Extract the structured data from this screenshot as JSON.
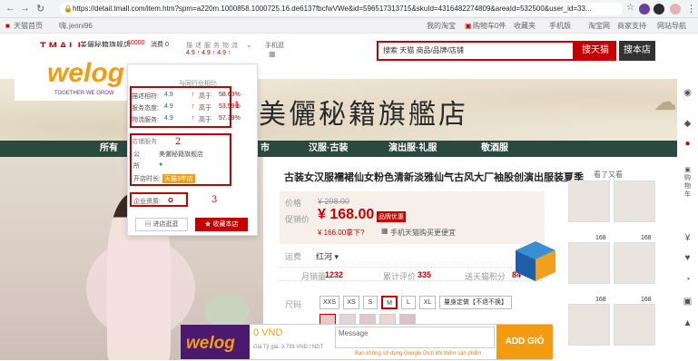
{
  "browser": {
    "url": "https://detail.tmall.com/item.htm?spm=a220m.1000858.1000725.16.de6137fbcfwVWe&id=596517313715&skuId=4316482274809&areaId=532500&user_id=33..."
  },
  "topbar": {
    "home": "天猫首页",
    "greeting": "嗨,",
    "user": "jenni96",
    "my_taobao": "我的淘宝",
    "cart": "购物车0件",
    "favorites": "收藏夹",
    "mobile": "手机版",
    "taobao": "淘宝网",
    "seller": "商家支持",
    "sitemap": "网站导航"
  },
  "shop_header": {
    "shop_name": "美儷秘籍旗舰店",
    "stat_labels": [
      "描",
      "述",
      "服",
      "务",
      "物",
      "流"
    ],
    "score_a": "4.9",
    "score_b": "4.9",
    "score_c": "4.9",
    "phone_label": "手机逛",
    "coupon": "10000",
    "cat": "消费 0"
  },
  "search": {
    "placeholder": "搜索 天猫 商品/品牌/店铺",
    "btn_tmall": "搜天猫",
    "btn_shop": "搜本店"
  },
  "banner": {
    "title": "美儷秘籍旗艦店"
  },
  "catnav": [
    "所有",
    "市",
    "汉服·古装",
    "演出服·礼服",
    "敬酒服"
  ],
  "popup": {
    "compare_header": "与同行业相比",
    "rows": [
      {
        "label": "描述相符:",
        "score": "4.9",
        "dir": "高于",
        "pct": "58.63%"
      },
      {
        "label": "服务态度:",
        "score": "4.9",
        "dir": "高于",
        "pct": "53.59%"
      },
      {
        "label": "物流服务:",
        "score": "4.9",
        "dir": "高于",
        "pct": "57.39%"
      }
    ],
    "service_header": "店铺服务",
    "company_label": "公",
    "company_name": "美儷秘籍旗舰店",
    "location_label": "所",
    "location_val": "",
    "open_label": "开店时长:",
    "open_val": "天猫3年店",
    "cert_label": "企业资质:",
    "enter_btn": "进店逛逛",
    "fav_btn": "收藏本店",
    "annot_1": "1",
    "annot_2": "2",
    "annot_3": "3"
  },
  "logo": {
    "brand": "welog",
    "tagline": "TOGETHER WE GROW"
  },
  "product": {
    "title": "古装女汉服襦裙仙女粉色清新淡雅仙气古风大厂袖股创演出服装夏季",
    "orig_label": "价格",
    "orig_price": "¥ 298.00",
    "promo_label": "促销价",
    "price": "¥ 168.00",
    "promo_tag": "品牌优惠",
    "coupon_text": "¥ 166.00拿下?",
    "mobile_tip": "手机天猫购买更便宜",
    "ship_label": "运费",
    "ship_val": "红河 ▾",
    "monthly_label": "月销量",
    "monthly": "1232",
    "reviews_label": "累计评价",
    "reviews": "335",
    "points_label": "送天猫积分",
    "points": "84",
    "size_label": "尺码",
    "sizes": [
      "XXS",
      "XS",
      "S",
      "M",
      "L",
      "XL",
      "量身定做【不退不换】"
    ]
  },
  "thumbs_label": "看了又看",
  "thumb_price": "168",
  "bottombar": {
    "price_vnd": "0 VND",
    "rate": "Giá Tỷ giá: 3.739 VND / NDT",
    "message_label": "Message",
    "hint": "Bạn không sử dụng Google Dịch khi thêm sản phẩm",
    "add_btn": "ADD GIỎ"
  },
  "colors": {
    "accent": "#c40000",
    "nav": "#2a4a3f",
    "orange": "#f39c12"
  }
}
